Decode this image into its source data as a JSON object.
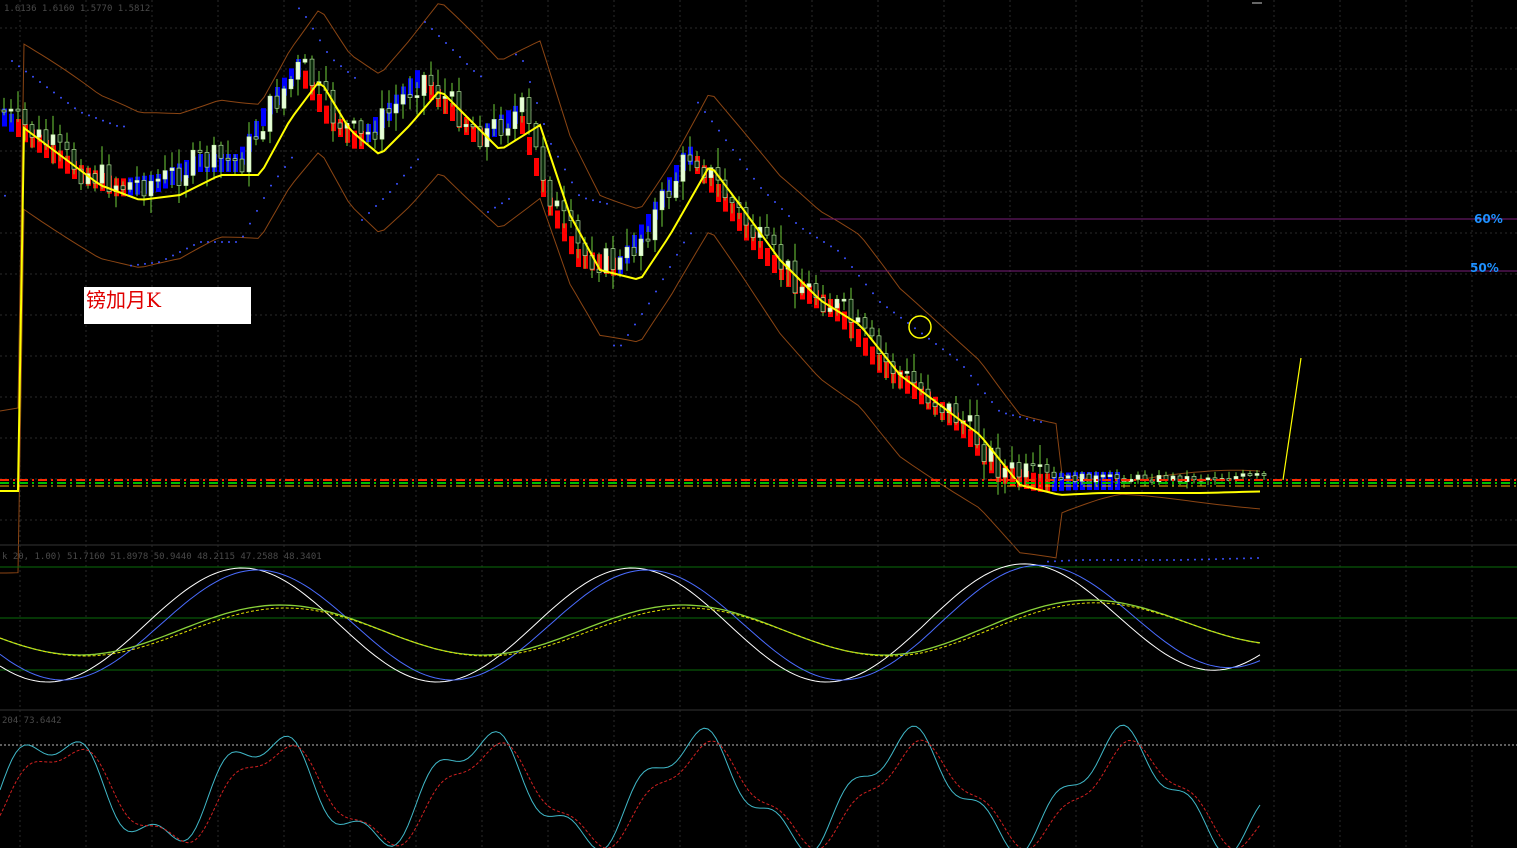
{
  "chart_title": "镑加月K",
  "main_panel": {
    "ohlc_readout": "1.6136 1.6160 1.5770 1.5812",
    "fib_levels": [
      {
        "label": "60%",
        "price_fraction": 0.6
      },
      {
        "label": "50%",
        "price_fraction": 0.5
      }
    ]
  },
  "stoch_panel": {
    "readout": "k 20, 1.00) 51.7160 51.8978 50.9440 48.2115 47.2588 48.3401"
  },
  "osc_panel": {
    "readout": "204 73.6442"
  },
  "colors": {
    "background": "#000000",
    "grid": "#2f2f2f",
    "candle": "#d8f5c8",
    "wick": "#6fcf3a",
    "ma": "#ffff00",
    "bollinger": "#8b4513",
    "bear_bar": "#ff0000",
    "bull_bar": "#0000ff",
    "psar": "#3a50ff",
    "fib_line": "#7a1e7a",
    "fib_text": "#1e90ff"
  },
  "chart_data": [
    {
      "type": "candlestick",
      "title": "镑加月K",
      "x_range": [
        0,
        179
      ],
      "series": [
        {
          "name": "",
          "indicator": "close-trend",
          "note_shape": "down-trend with consolidation"
        }
      ],
      "close_trend": [
        1.62,
        1.58,
        1.55,
        1.52,
        1.54,
        1.66,
        1.65,
        1.62,
        1.65,
        1.62,
        1.6,
        1.52,
        1.47,
        1.45,
        1.48,
        1.55,
        1.58,
        1.52,
        1.45,
        1.38,
        1.3,
        1.22,
        1.18,
        1.16,
        1.17,
        1.18
      ],
      "grid": true
    },
    {
      "type": "line",
      "title": "",
      "ylim": [
        0,
        100
      ],
      "grid": true
    },
    {
      "type": "line",
      "title": "",
      "ylim": [
        0,
        100
      ],
      "grid": true
    }
  ]
}
